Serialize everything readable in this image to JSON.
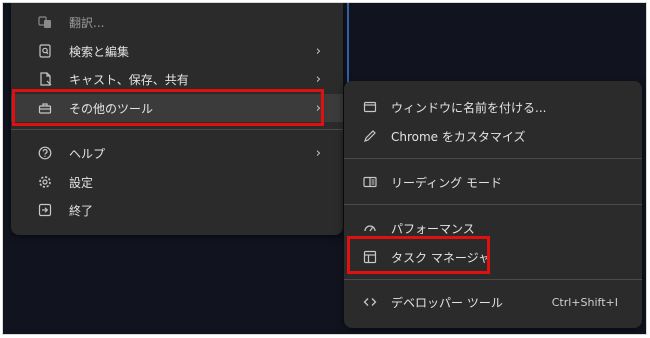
{
  "main_menu": {
    "items": [
      {
        "label": "翻訳...",
        "icon": "translate-icon"
      },
      {
        "label": "検索と編集",
        "icon": "search-page-icon"
      },
      {
        "label": "キャスト、保存、共有",
        "icon": "cast-save-share-icon"
      },
      {
        "label": "その他のツール",
        "icon": "toolbox-icon"
      },
      {
        "label": "ヘルプ",
        "icon": "help-icon"
      },
      {
        "label": "設定",
        "icon": "gear-icon"
      },
      {
        "label": "終了",
        "icon": "exit-icon"
      }
    ]
  },
  "sub_menu": {
    "items": [
      {
        "label": "ウィンドウに名前を付ける...",
        "icon": "window-icon"
      },
      {
        "label": "Chrome をカスタマイズ",
        "icon": "pencil-icon"
      },
      {
        "label": "リーディング モード",
        "icon": "reading-mode-icon"
      },
      {
        "label": "パフォーマンス",
        "icon": "speedometer-icon"
      },
      {
        "label": "タスク マネージャ",
        "icon": "task-manager-icon"
      },
      {
        "label": "デベロッパー ツール",
        "icon": "code-icon",
        "shortcut": "Ctrl+Shift+I"
      }
    ]
  },
  "colors": {
    "background": "#11141f",
    "menu": "#2b2b2b",
    "highlight": "#e01010",
    "text": "#e3e3e3"
  }
}
